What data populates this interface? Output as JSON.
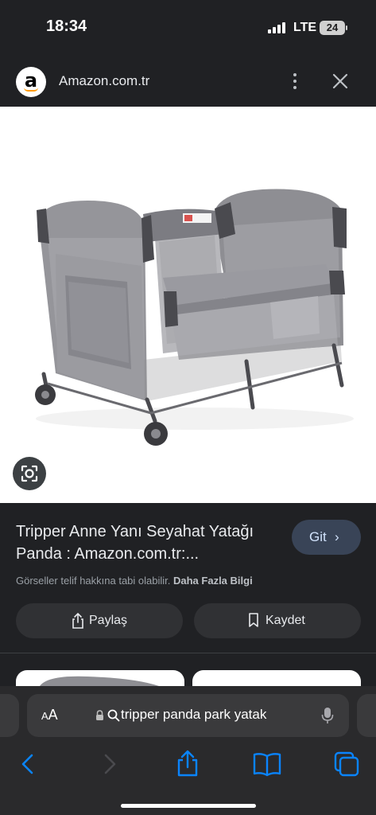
{
  "status_bar": {
    "time": "18:34",
    "network": "LTE",
    "battery": "24"
  },
  "header": {
    "site_title": "Amazon.com.tr",
    "logo_letter": "a"
  },
  "result": {
    "title": "Tripper Anne Yanı Seyahat Yatağı Panda : Amazon.com.tr:...",
    "visit_label": "Git",
    "visit_chevron": "›",
    "copyright_note": "Görseller telif hakkına tabi olabilir.",
    "more_info": "Daha Fazla Bilgi",
    "share_label": "Paylaş",
    "save_label": "Kaydet"
  },
  "browser": {
    "text_size_label_small": "A",
    "text_size_label_big": "A",
    "address_text": "tripper panda park yatak"
  },
  "icons": [
    "signal-icon",
    "battery-icon",
    "amazon-logo-icon",
    "more-vertical-icon",
    "close-icon",
    "lens-icon",
    "chevron-right-icon",
    "share-icon",
    "bookmark-icon",
    "lock-icon",
    "search-icon",
    "microphone-icon",
    "back-icon",
    "forward-icon",
    "book-icon",
    "tabs-icon"
  ],
  "colors": {
    "accent_blue": "#0a84ff",
    "visit_button": "#394457",
    "panel": "#202124"
  }
}
